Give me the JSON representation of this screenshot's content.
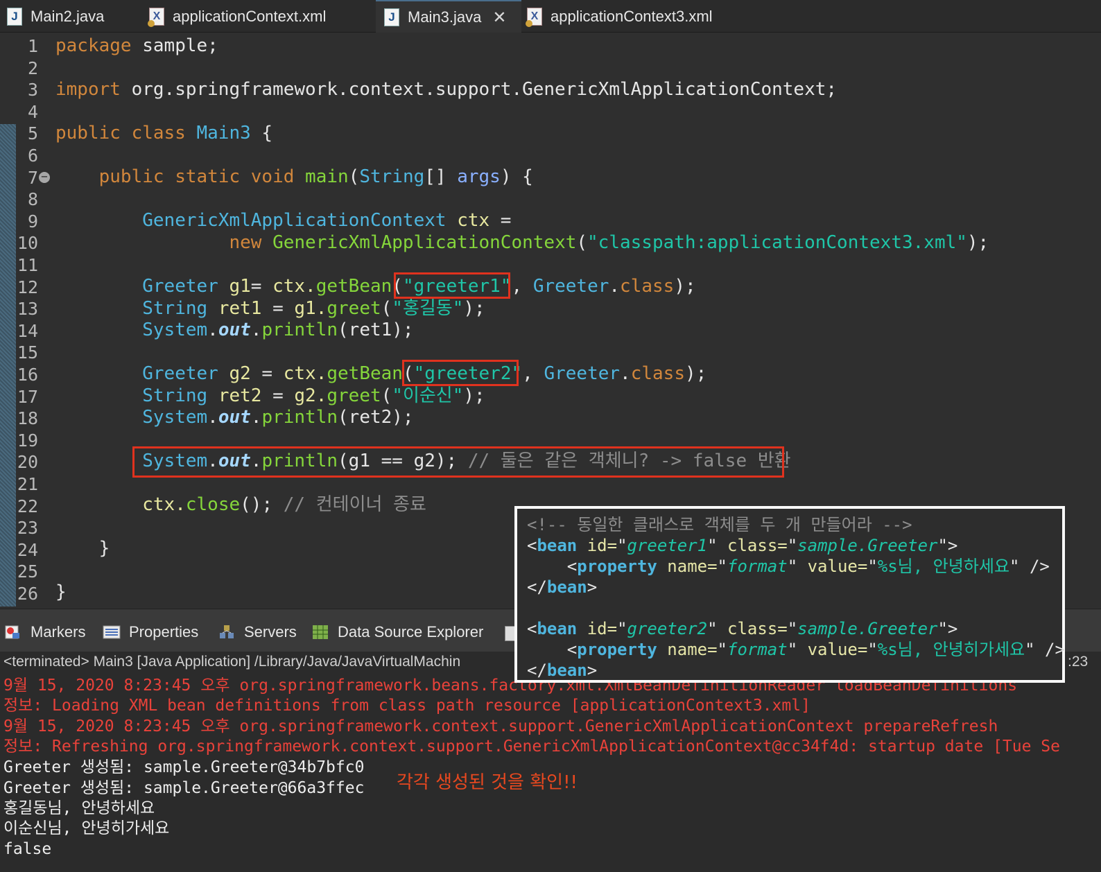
{
  "tabs": [
    {
      "label": "Main2.java",
      "icon": "java-file-icon"
    },
    {
      "label": "applicationContext.xml",
      "icon": "xml-file-icon"
    },
    {
      "label": "Main3.java",
      "icon": "java-file-icon",
      "active": true
    },
    {
      "label": "applicationContext3.xml",
      "icon": "xml-file-icon"
    }
  ],
  "line_numbers": [
    "1",
    "2",
    "3",
    "4",
    "5",
    "6",
    "7",
    "8",
    "9",
    "10",
    "11",
    "12",
    "13",
    "14",
    "15",
    "16",
    "17",
    "18",
    "19",
    "20",
    "21",
    "22",
    "23",
    "24",
    "25",
    "26"
  ],
  "code": {
    "l1": {
      "kw": "package",
      "rest": " sample;"
    },
    "l3": {
      "kw": "import",
      "rest": " org.springframework.context.support.GenericXmlApplicationContext;"
    },
    "l5": {
      "kw": "public class",
      "name": "Main3",
      "rest": " {"
    },
    "l7": {
      "kw": "public static void",
      "fn": "main",
      "open": "(",
      "ty": "String",
      "arr": "[] ",
      "arg": "args",
      "close": ") {"
    },
    "l9": {
      "ty": "GenericXmlApplicationContext",
      "var": "ctx",
      "rest": " ="
    },
    "l10": {
      "kw": "new",
      "fn": "GenericXmlApplicationContext",
      "open": "(",
      "str": "\"classpath:applicationContext3.xml\"",
      "close": ");"
    },
    "l12": {
      "ty": "Greeter",
      "var": "g1",
      "eq": "= ",
      "obj": "ctx.",
      "fn": "getBean",
      "open": "(",
      "str": "\"greeter1\"",
      "comma": ", ",
      "ty2": "Greeter",
      "dot": ".",
      "kw": "class",
      "close": ");"
    },
    "l13": {
      "ty": "String",
      "var": "ret1",
      "eq": " = ",
      "obj": "g1.",
      "fn": "greet",
      "open": "(",
      "str": "\"홍길동\"",
      "close": ");"
    },
    "l14": {
      "ty": "System",
      "dot": ".",
      "it": "out",
      "dot2": ".",
      "fn": "println",
      "rest": "(ret1);"
    },
    "l16": {
      "ty": "Greeter",
      "var": "g2",
      "eq": " = ",
      "obj": "ctx.",
      "fn": "getBean",
      "open": "(",
      "str": "\"greeter2\"",
      "comma": ", ",
      "ty2": "Greeter",
      "dot": ".",
      "kw": "class",
      "close": ");"
    },
    "l17": {
      "ty": "String",
      "var": "ret2",
      "eq": " = ",
      "obj": "g2.",
      "fn": "greet",
      "open": "(",
      "str": "\"이순신\"",
      "close": ");"
    },
    "l18": {
      "ty": "System",
      "dot": ".",
      "it": "out",
      "dot2": ".",
      "fn": "println",
      "rest": "(ret2);"
    },
    "l20": {
      "ty": "System",
      "dot": ".",
      "it": "out",
      "dot2": ".",
      "fn": "println",
      "rest": "(g1 == g2); ",
      "cm": "// 둘은 같은 객체니? -> false 반환"
    },
    "l22": {
      "obj": "ctx.",
      "fn": "close",
      "rest": "(); ",
      "cm": "// 컨테이너 종료"
    },
    "l24": {
      "rest": "}"
    },
    "l26": {
      "rest": "}"
    }
  },
  "xml_popup": {
    "comment": "<!-- 동일한 클래스로 객체를 두 개 만들어라 -->",
    "bean1": {
      "id": "greeter1",
      "class": "sample.Greeter",
      "prop_name": "format",
      "prop_value": "%s님, 안녕하세요"
    },
    "bean2": {
      "id": "greeter2",
      "class": "sample.Greeter",
      "prop_name": "format",
      "prop_value": "%s님, 안녕히가세요"
    },
    "lt": "<",
    "gt": ">",
    "bean_tag": "bean",
    "property_tag": "property",
    "close_bean": "</",
    "self_close": " />",
    "attr_id": "id=",
    "attr_class": "class=",
    "attr_name": "name=",
    "attr_value": "value=",
    "q": "\""
  },
  "bottom_tabs": [
    {
      "label": "Markers",
      "icon": "markers-icon"
    },
    {
      "label": "Properties",
      "icon": "properties-icon"
    },
    {
      "label": "Servers",
      "icon": "servers-icon"
    },
    {
      "label": "Data Source Explorer",
      "icon": "data-source-icon"
    }
  ],
  "console": {
    "header": "<terminated> Main3 [Java Application] /Library/Java/JavaVirtualMachin",
    "header_tail": ":23",
    "lines": [
      {
        "text": "9월 15, 2020 8:23:45 오후 org.springframework.beans.factory.xml.XmlBeanDefinitionReader loadBeanDefinitions",
        "color": "red"
      },
      {
        "text": "정보: Loading XML bean definitions from class path resource [applicationContext3.xml]",
        "color": "red"
      },
      {
        "text": "9월 15, 2020 8:23:45 오후 org.springframework.context.support.GenericXmlApplicationContext prepareRefresh",
        "color": "red"
      },
      {
        "text": "정보: Refreshing org.springframework.context.support.GenericXmlApplicationContext@cc34f4d: startup date [Tue Se",
        "color": "red"
      },
      {
        "text": "Greeter 생성됨: sample.Greeter@34b7bfc0",
        "color": "white"
      },
      {
        "text": "Greeter 생성됨: sample.Greeter@66a3ffec",
        "color": "white"
      },
      {
        "text": "홍길동님, 안녕하세요",
        "color": "white"
      },
      {
        "text": "이순신님, 안녕히가세요",
        "color": "white"
      },
      {
        "text": "false",
        "color": "white"
      }
    ],
    "note": "각각 생성된 것을 확인!!"
  },
  "colors": {
    "highlight_box": "#e0321e",
    "keyword": "#d2873c",
    "type": "#4fb6df",
    "string": "#1fc6a8",
    "console_error": "#e9423a"
  }
}
